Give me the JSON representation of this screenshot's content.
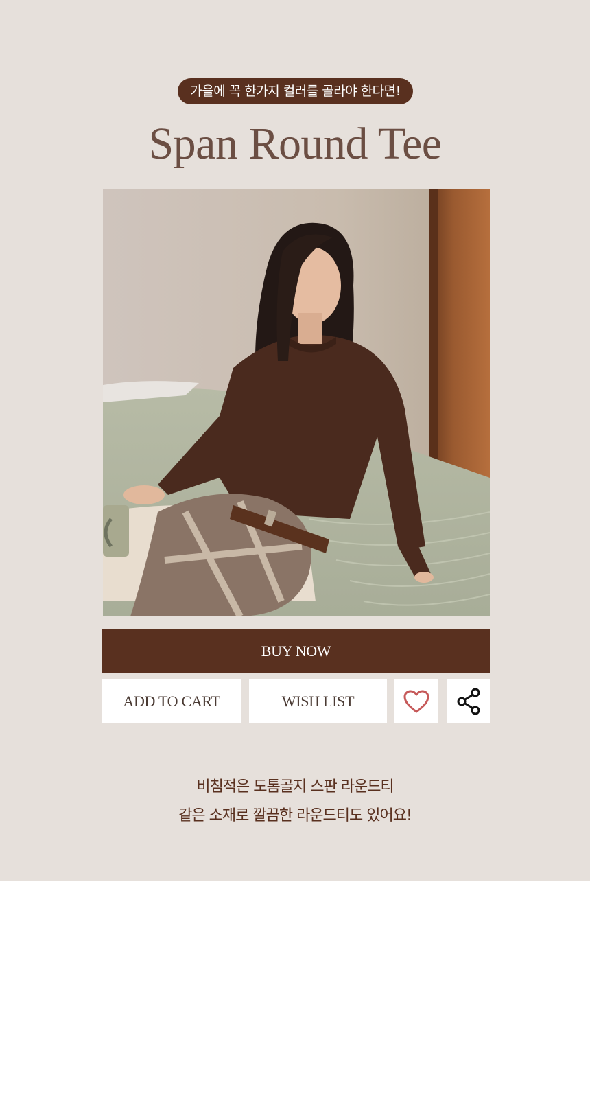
{
  "header": {
    "tagline": "가을에 꼭 한가지 컬러를 골라야 한다면!",
    "product_title": "Span Round Tee"
  },
  "product_image": {
    "alt": "Woman in brown round-neck knit tee sitting on a bed"
  },
  "actions": {
    "buy_now_label": "BUY NOW",
    "add_to_cart_label": "ADD TO CART",
    "wish_list_label": "WISH LIST",
    "heart_icon": "heart-icon",
    "share_icon": "share-icon"
  },
  "description": {
    "line1": "비침적은 도톰골지 스판 라운드티",
    "line2": "같은 소재로 깔끔한 라운드티도 있어요!"
  },
  "colors": {
    "background": "#e6e0db",
    "accent_brown": "#59301f",
    "title_brown": "#6b4e43",
    "heart_red": "#c65a5a"
  }
}
